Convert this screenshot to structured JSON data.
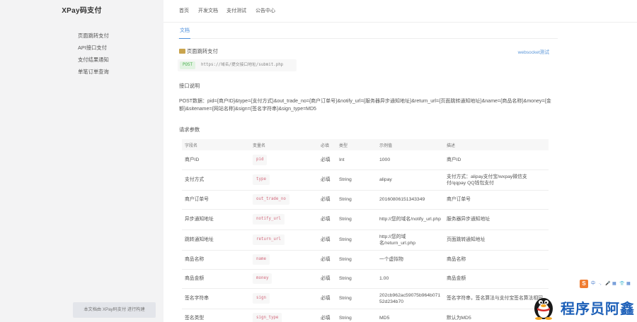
{
  "sidebar": {
    "brand": "XPay码支付",
    "items": [
      {
        "label": "页面跳转支付"
      },
      {
        "label": "API接口支付"
      },
      {
        "label": "支付结果通知"
      },
      {
        "label": "单笔订单查询"
      }
    ],
    "footer": "本文档由 XPay码支付 进行构建"
  },
  "topnav": {
    "items": [
      {
        "label": "首页"
      },
      {
        "label": "开发文档"
      },
      {
        "label": "支付测试"
      },
      {
        "label": "公告中心"
      }
    ]
  },
  "main": {
    "tab": "文档",
    "section_title": "页面跳转支付",
    "ws_link": "websocket测试",
    "endpoint": {
      "method": "POST",
      "url": "https://域名/提交接口地址/submit.php"
    },
    "desc_title": "接口说明",
    "desc_text": "POST数据：pid={商户ID}&type={支付方式}&out_trade_no={商户订单号}&notify_url={服务器异步通知地址}&return_url={页面跳转通知地址}&name={商品名称}&money={金额}&sitename={网站名称}&sign={签名字符串}&sign_type=MD5",
    "params_title": "请求参数",
    "table": {
      "headers": [
        "字段名",
        "变量名",
        "必填",
        "类型",
        "示例值",
        "描述"
      ],
      "rows": [
        {
          "field": "商户ID",
          "var": "pid",
          "required": "必填",
          "type": "Int",
          "example": "1000",
          "desc": "商户ID"
        },
        {
          "field": "支付方式",
          "var": "type",
          "required": "必填",
          "type": "String",
          "example": "alipay",
          "desc": "支付方式：alipay支付宝/wxpay微信支付/qqpay QQ钱包支付"
        },
        {
          "field": "商户订单号",
          "var": "out_trade_no",
          "required": "必填",
          "type": "String",
          "example": "20160806151343349",
          "desc": "商户订单号"
        },
        {
          "field": "异步通知地址",
          "var": "notify_url",
          "required": "必填",
          "type": "String",
          "example": "http://您的域名/notify_url.php",
          "desc": "服务器异步通知地址"
        },
        {
          "field": "跳转通知地址",
          "var": "return_url",
          "required": "必填",
          "type": "String",
          "example": "http://您的域名/return_url.php",
          "desc": "页面跳转通知地址"
        },
        {
          "field": "商品名称",
          "var": "name",
          "required": "必填",
          "type": "String",
          "example": "一个虚拟物",
          "desc": "商品名称"
        },
        {
          "field": "商品金额",
          "var": "money",
          "required": "必填",
          "type": "String",
          "example": "1.00",
          "desc": "商品金额"
        },
        {
          "field": "签名字符串",
          "var": "sign",
          "required": "必填",
          "type": "String",
          "example": "202cb962ac59075b964b07152d234b70",
          "desc": "签名字符串，签名算法与支付宝签名算法相同"
        },
        {
          "field": "签名类型",
          "var": "sign_type",
          "required": "必填",
          "type": "String",
          "example": "MD5",
          "desc": "默认为MD5"
        }
      ]
    }
  },
  "ime": {
    "logo": "S",
    "glyphs": [
      "中",
      "·,",
      "🎤",
      "▦",
      "👕",
      "▦"
    ]
  },
  "watermark": "程序员阿鑫",
  "colors": {
    "accent": "#4a8edc",
    "sidebar_bg": "#f3f3f4",
    "code_text": "#d36a7d",
    "method_green": "#4caf50"
  }
}
